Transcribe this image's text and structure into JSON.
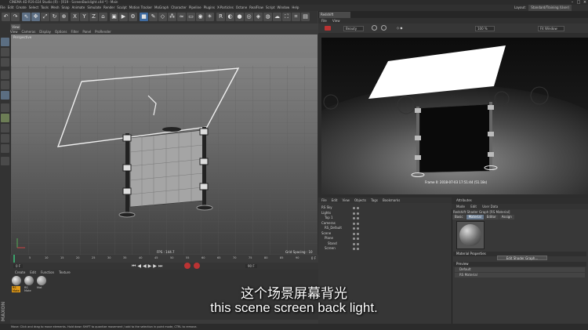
{
  "window": {
    "title": "CINEMA 4D R19.024 Studio (R) - [R19 - ScreenBacklight.c4d *] - Main",
    "layout_label": "Layout:",
    "layout_value": "Standard/Training (User)"
  },
  "menubar": [
    "File",
    "Edit",
    "Create",
    "Select",
    "Tools",
    "Mesh",
    "Snap",
    "Animate",
    "Simulate",
    "Render",
    "Sculpt",
    "Motion Tracker",
    "MoGraph",
    "Character",
    "Pipeline",
    "Plugins",
    "X-Particles",
    "Octane",
    "RealFlow",
    "Script",
    "Window",
    "Help"
  ],
  "viewport": {
    "tab": "View",
    "menu": [
      "View",
      "Cameras",
      "Display",
      "Options",
      "Filter",
      "Panel",
      "ProRender"
    ],
    "camera_label": "Perspective",
    "fps_label": "FPS : 144.7",
    "grid_label": "Grid Spacing : 10 cm"
  },
  "timeline": {
    "ticks": [
      "0",
      "5",
      "10",
      "15",
      "20",
      "25",
      "30",
      "35",
      "40",
      "45",
      "50",
      "55",
      "60",
      "65",
      "70",
      "75",
      "80",
      "85",
      "90"
    ],
    "frame_end": "0 F",
    "current_frame": "0 F",
    "end_frame": "90 F"
  },
  "material_manager": {
    "menu": [
      "Create",
      "Edit",
      "Function",
      "Texture"
    ],
    "materials": [
      "RS Mate",
      "RS Mate",
      "Mat"
    ]
  },
  "render_view": {
    "title": "Redshift RenderView",
    "menu": [
      "File",
      "View"
    ],
    "beauty_select": "Beauty",
    "zoom": "100 %",
    "fit": "Fit Window",
    "frame_label": "Frame 0: 2018-07-03 17:51:44 (51.18s)"
  },
  "object_manager": {
    "menu": [
      "File",
      "Edit",
      "View",
      "Objects",
      "Tags",
      "Bookmarks"
    ],
    "objects": [
      "RS Sky",
      "Lights",
      "Top 1",
      "Cameras",
      "RS_Default",
      "Scene",
      "Plane",
      "Stand",
      "Screen"
    ]
  },
  "attributes": {
    "header": "Attributes",
    "menu": [
      "Mode",
      "Edit",
      "User Data"
    ],
    "material_title": "Redshift Shader Graph [RS Material]",
    "tabs": [
      "Basic",
      "Material",
      "Editor",
      "Assign"
    ],
    "section_properties": "Material Properties",
    "edit_button": "Edit Shader Graph...",
    "section_preview": "Preview",
    "rows": [
      "Default",
      "RS Material"
    ]
  },
  "statusbar": "Move: Click and drag to move elements. Hold down SHIFT to quantize movement / add to the selection in point mode, CTRL to remove.",
  "subtitles": {
    "chinese": "这个场景屏幕背光",
    "english": "this scene screen back light."
  },
  "watermark": "MAXON",
  "colors": {
    "accent_orange": "#e07a1a",
    "selection_blue": "#4a6a8f"
  }
}
